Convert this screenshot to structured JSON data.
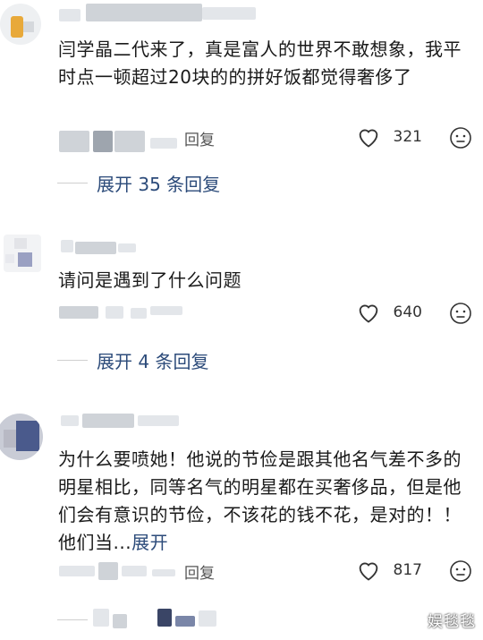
{
  "comments": [
    {
      "text": "闫学晶二代来了，真是富人的世界不敢想象，我平时点一顿超过20块的的拼好饭都觉得奢侈了",
      "reply_label": "回复",
      "likes": "321",
      "expand_label": "展开 35 条回复"
    },
    {
      "text": "请问是遇到了什么问题",
      "reply_label": "回复",
      "likes": "640",
      "expand_label": "展开 4 条回复"
    },
    {
      "text": "为什么要喷她！他说的节俭是跟其他名气差不多的明星相比，同等名气的明星都在买奢侈品，但是他们会有意识的节俭，不该花的钱不花，是对的！！他们当...",
      "more_label": "展开",
      "reply_label": "回复",
      "likes": "817"
    }
  ],
  "watermark": "娱毯毯",
  "icons": {
    "like": "heart-outline-icon",
    "emoji": "emoji-face-icon"
  }
}
